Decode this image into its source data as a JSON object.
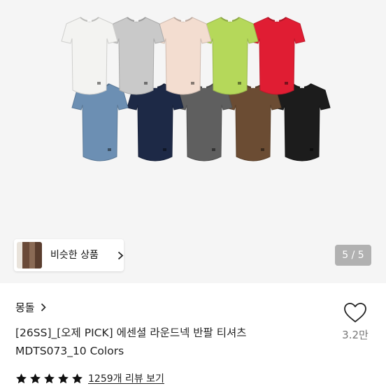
{
  "product": {
    "image": {
      "alt": "에센셜 라운드넥 반팔 티셔츠 10 colors",
      "icon": "t-shirt-colors-image",
      "colors": [
        "#f3f3f1",
        "#c9c9c9",
        "#f3ddd0",
        "#b5d85a",
        "#e01d33",
        "#6c8fb3",
        "#1d2946",
        "#5f5f5f",
        "#6b4c33",
        "#1c1c1c"
      ]
    },
    "similar_button": {
      "label": "비슷한 상품",
      "icon": "chevron-right-icon"
    },
    "page_indicator": "5 / 5",
    "brand": {
      "name": "몽돌",
      "icon": "chevron-right-icon"
    },
    "title_lines": [
      "[26SS]_[오제 PICK] 에센셜 라운드넥 반팔 티셔츠",
      "MDTS073_10 Colors"
    ],
    "like": {
      "count": "3.2만",
      "icon": "heart-icon"
    },
    "rating": {
      "stars": 5,
      "review_link": "1259개 리뷰 보기",
      "icon": "star-icon"
    }
  }
}
